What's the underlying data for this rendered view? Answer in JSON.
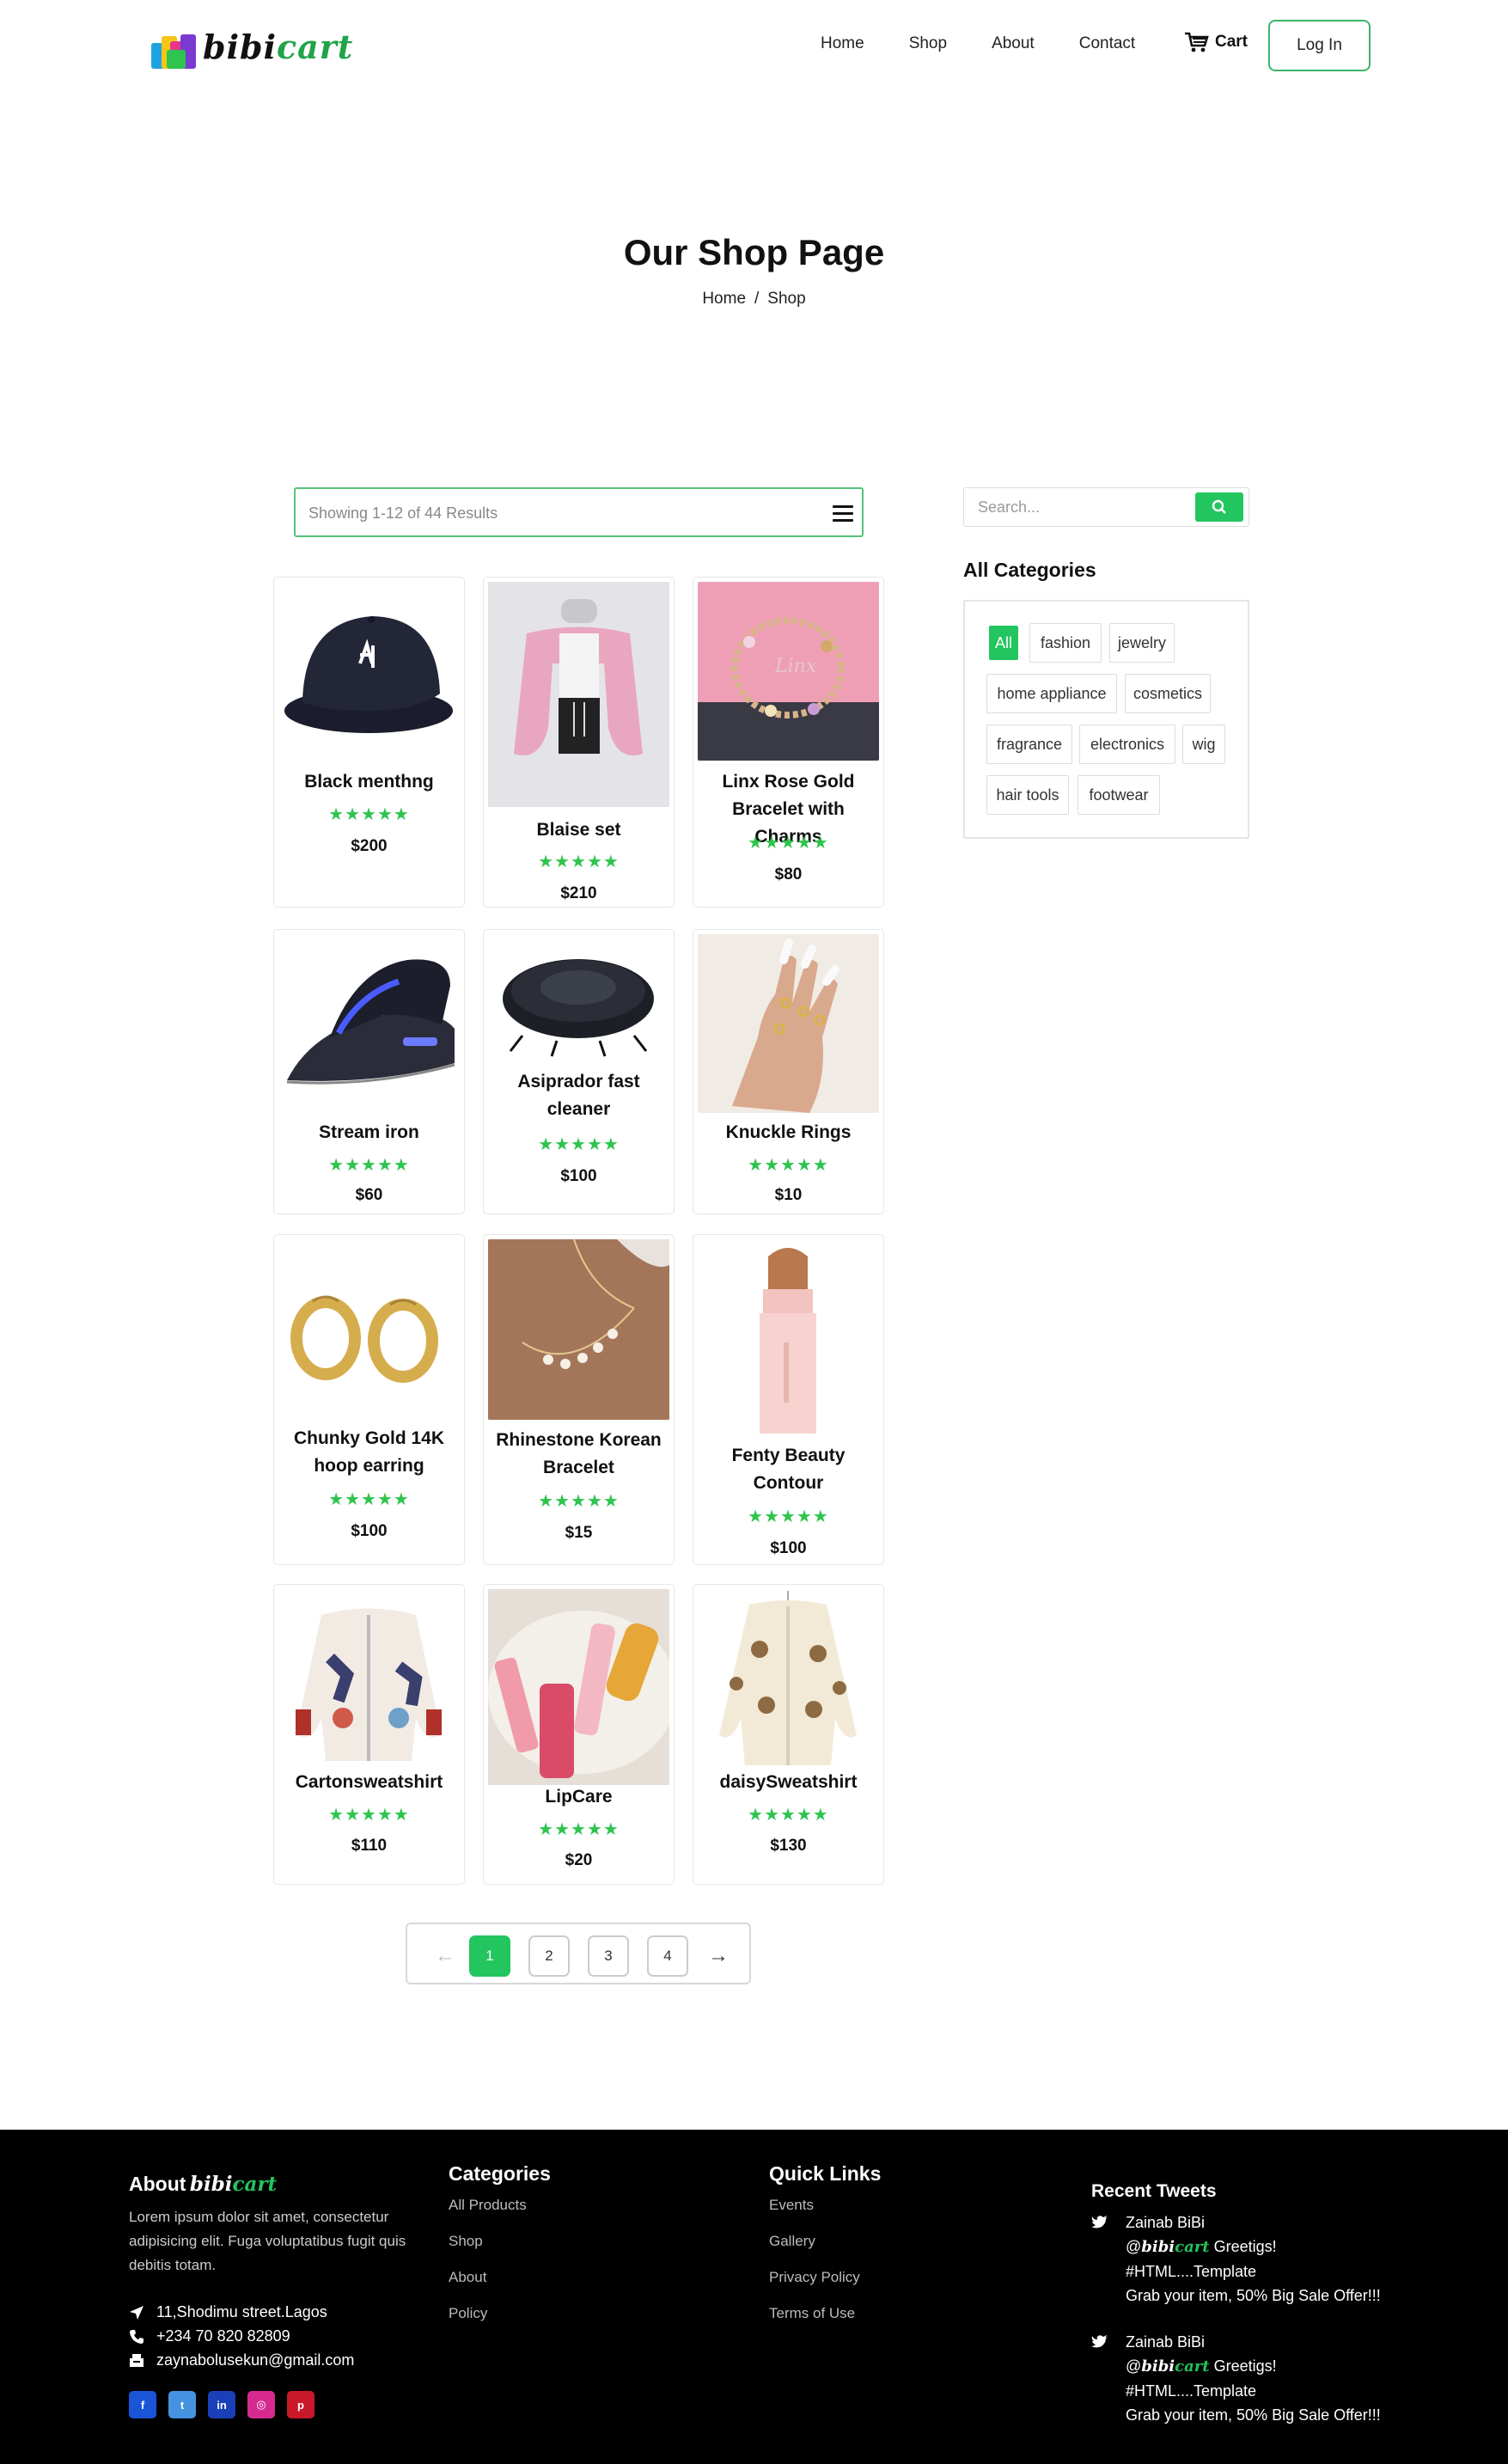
{
  "header": {
    "logo": {
      "part1": "bibi",
      "part2": "cart"
    },
    "nav": [
      "Home",
      "Shop",
      "About",
      "Contact"
    ],
    "cart_label": "Cart",
    "login_label": "Log In"
  },
  "hero": {
    "title": "Our Shop Page",
    "breadcrumb": {
      "home": "Home",
      "sep": "/",
      "current": "Shop"
    }
  },
  "toolbar": {
    "showing_text": "Showing 1-12 of 44 Results",
    "menu_icon": "hamburger-icon"
  },
  "products": [
    {
      "name": "Black menthng",
      "stars": "★★★★★",
      "price": "$200",
      "image": "black-cap"
    },
    {
      "name": "Blaise set",
      "stars": "★★★★★",
      "price": "$210",
      "image": "pink-cardigan-set"
    },
    {
      "name": "Linx Rose Gold Bracelet with Charms",
      "stars": "★★★★★",
      "price": "$80",
      "image": "charm-bracelet"
    },
    {
      "name": "Stream iron",
      "stars": "★★★★★",
      "price": "$60",
      "image": "steam-iron"
    },
    {
      "name": "Asiprador fast cleaner",
      "stars": "★★★★★",
      "price": "$100",
      "image": "robot-vacuum"
    },
    {
      "name": "Knuckle Rings",
      "stars": "★★★★★",
      "price": "$10",
      "image": "rings-hand"
    },
    {
      "name": "Chunky Gold 14K hoop earring",
      "stars": "★★★★★",
      "price": "$100",
      "image": "gold-hoops"
    },
    {
      "name": "Rhinestone Korean Bracelet",
      "stars": "★★★★★",
      "price": "$15",
      "image": "rhinestone-bracelet"
    },
    {
      "name": "Fenty Beauty Contour",
      "stars": "★★★★★",
      "price": "$100",
      "image": "contour-stick"
    },
    {
      "name": "Cartonsweatshirt",
      "stars": "★★★★★",
      "price": "$110",
      "image": "cartoon-cardigan"
    },
    {
      "name": "LipCare",
      "stars": "★★★★★",
      "price": "$20",
      "image": "lip-products"
    },
    {
      "name": "daisySweatshirt",
      "stars": "★★★★★",
      "price": "$130",
      "image": "daisy-cardigan"
    }
  ],
  "pagination": {
    "prev": "←",
    "pages": [
      "1",
      "2",
      "3",
      "4"
    ],
    "current": "1",
    "next": "→"
  },
  "sidebar": {
    "search_placeholder": "Search...",
    "categories_title": "All Categories",
    "categories": [
      "All",
      "fashion",
      "jewelry",
      "home appliance",
      "cosmetics",
      "fragrance",
      "electronics",
      "wig",
      "hair tools",
      "footwear"
    ],
    "active_category": "All"
  },
  "footer": {
    "about_title": "About",
    "about_text": "Lorem ipsum dolor sit amet, consectetur adipisicing elit. Fuga voluptatibus fugit quis debitis totam.",
    "address": "11,Shodimu street.Lagos",
    "phone": "+234 70 820 82809",
    "email": "zaynabolusekun@gmail.com",
    "socials": [
      "facebook",
      "twitter",
      "linkedin",
      "instagram",
      "pinterest"
    ],
    "categories_title": "Categories",
    "categories": [
      "All Products",
      "Shop",
      "About",
      "Policy"
    ],
    "quicklinks_title": "Quick Links",
    "quicklinks": [
      "Events",
      "Gallery",
      "Privacy Policy",
      "Terms of Use"
    ],
    "tweets_title": "Recent Tweets",
    "tweets": [
      {
        "author": "Zainab BiBi",
        "handle_prefix": "@",
        "greeting": "Greetigs!",
        "tag": "#HTML....Template",
        "text": "Grab your item, 50% Big Sale Offer!!!"
      },
      {
        "author": "Zainab BiBi",
        "handle_prefix": "@",
        "greeting": "Greetigs!",
        "tag": "#HTML....Template",
        "text": "Grab your item, 50% Big Sale Offer!!!"
      }
    ]
  },
  "colors": {
    "accent": "#22c55e",
    "footer_bg": "#000000",
    "star": "#2ec44f"
  }
}
